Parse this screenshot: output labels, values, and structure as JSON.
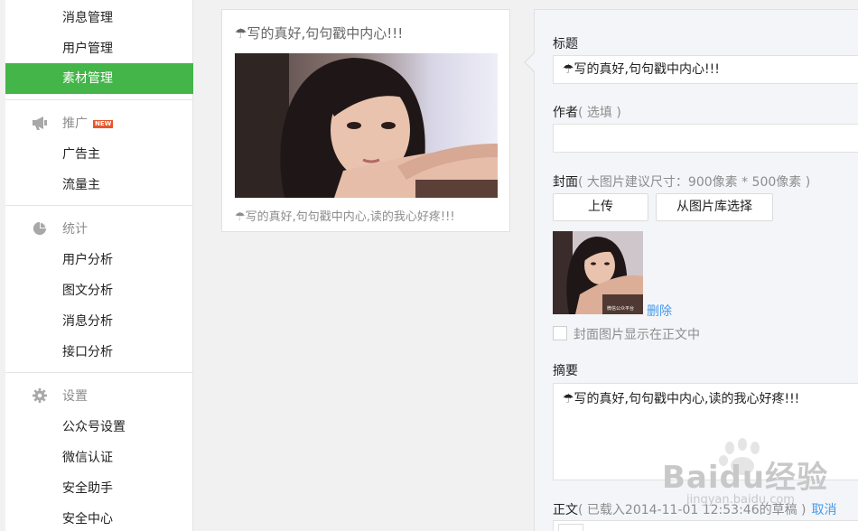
{
  "sidebar": {
    "top_items": [
      {
        "label": "消息管理"
      },
      {
        "label": "用户管理"
      },
      {
        "label": "素材管理",
        "active": true
      }
    ],
    "groups": [
      {
        "title": "推广",
        "icon": "megaphone-icon",
        "badge": "NEW",
        "items": [
          {
            "label": "广告主"
          },
          {
            "label": "流量主"
          }
        ]
      },
      {
        "title": "统计",
        "icon": "pie-chart-icon",
        "items": [
          {
            "label": "用户分析"
          },
          {
            "label": "图文分析"
          },
          {
            "label": "消息分析"
          },
          {
            "label": "接口分析"
          }
        ]
      },
      {
        "title": "设置",
        "icon": "gear-icon",
        "items": [
          {
            "label": "公众号设置"
          },
          {
            "label": "微信认证"
          },
          {
            "label": "安全助手"
          },
          {
            "label": "安全中心"
          }
        ]
      }
    ],
    "active_color": "#44b549"
  },
  "preview": {
    "title": "☂写的真好,句句戳中内心!!!",
    "digest": "☂写的真好,句句戳中内心,读的我心好疼!!!",
    "image": "girl-leaning-on-railing-photo"
  },
  "editor": {
    "title_label": "标题",
    "title_value": "☂写的真好,句句戳中内心!!!",
    "author_label": "作者",
    "author_hint": "( 选填 )",
    "author_value": "",
    "cover_label": "封面",
    "cover_hint": "( 大图片建议尺寸：900像素 * 500像素 )",
    "upload_button": "上传",
    "library_button": "从图片库选择",
    "delete_link": "删除",
    "show_cover_checkbox": "封面图片显示在正文中",
    "show_cover_checked": false,
    "digest_label": "摘要",
    "digest_value": "☂写的真好,句句戳中内心,读的我心好疼!!!",
    "body_label": "正文",
    "body_status": "( 已载入2014-11-01 12:53:46的草稿 )",
    "cancel_link": "取消",
    "thumb_caption": "微信公众平台"
  },
  "watermark": {
    "brand": "Baidu经验",
    "url": "jingyan.baidu.com"
  },
  "colors": {
    "link": "#459ae9",
    "hint": "#8d8d8d",
    "panel_bg": "#f4f5f9"
  }
}
